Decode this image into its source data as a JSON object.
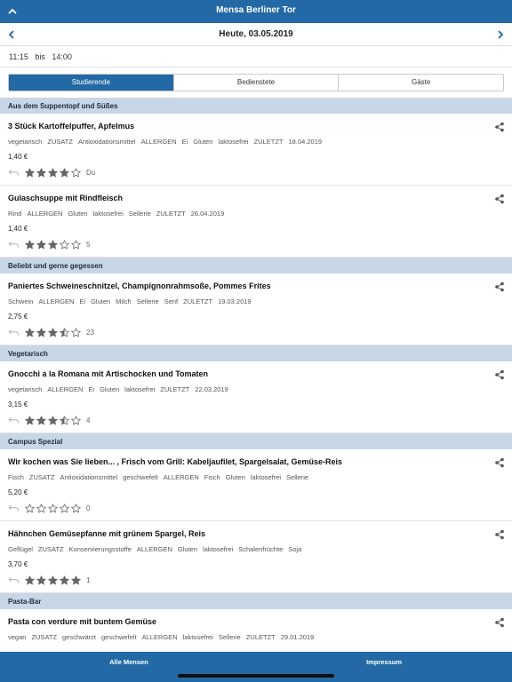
{
  "header": {
    "title": "Mensa Berliner Tor",
    "collapse_icon": "chevron-up-icon"
  },
  "datebar": {
    "date": "Heute, 03.05.2019",
    "prev_icon": "chevron-left-icon",
    "next_icon": "chevron-right-icon"
  },
  "opening": {
    "from": "11:15",
    "sep": "bis",
    "to": "14:00"
  },
  "tabs": [
    {
      "label": "Studierende",
      "active": true
    },
    {
      "label": "Bedienstete",
      "active": false
    },
    {
      "label": "Gäste",
      "active": false
    }
  ],
  "sections": [
    {
      "title": "Aus dem Suppentopf und Süßes",
      "meals": [
        {
          "name": "3 Stück Kartoffelpuffer, Apfelmus",
          "tags": [
            "vegetarisch",
            "ZUSATZ",
            "Antioxidationsmittel",
            "ALLERGEN",
            "Ei",
            "Gluten",
            "laktosefrei",
            "ZULETZT",
            "18.04.2019"
          ],
          "price": "1,40 €",
          "rating": 4,
          "count": "Du"
        },
        {
          "name": "Gulaschsuppe mit Rindfleisch",
          "tags": [
            "Rind",
            "ALLERGEN",
            "Gluten",
            "laktosefrei",
            "Sellerie",
            "ZULETZT",
            "26.04.2019"
          ],
          "price": "1,40 €",
          "rating": 3,
          "count": "5"
        }
      ]
    },
    {
      "title": "Beliebt und gerne gegessen",
      "meals": [
        {
          "name": "Paniertes Schweineschnitzel, Champignonrahmsoße, Pommes Frites",
          "tags": [
            "Schwein",
            "ALLERGEN",
            "Ei",
            "Gluten",
            "Milch",
            "Sellerie",
            "Senf",
            "ZULETZT",
            "19.03.2019"
          ],
          "price": "2,75 €",
          "rating": 3.5,
          "count": "23"
        }
      ]
    },
    {
      "title": "Vegetarisch",
      "meals": [
        {
          "name": "Gnocchi a la Romana mit Artischocken und Tomaten",
          "tags": [
            "vegetarisch",
            "ALLERGEN",
            "Ei",
            "Gluten",
            "laktosefrei",
            "ZULETZT",
            "22.03.2019"
          ],
          "price": "3,15 €",
          "rating": 3.5,
          "count": "4"
        }
      ]
    },
    {
      "title": "Campus Spezial",
      "meals": [
        {
          "name": "Wir kochen was Sie lieben... , Frisch vom Grill: Kabeljaufilet, Spargelsalat, Gemüse-Reis",
          "tags": [
            "Fisch",
            "ZUSATZ",
            "Antioxidationsmittel",
            "geschwefelt",
            "ALLERGEN",
            "Fisch",
            "Gluten",
            "laktosefrei",
            "Sellerie"
          ],
          "price": "5,20 €",
          "rating": 0,
          "count": "0"
        },
        {
          "name": "Hähnchen Gemüsepfanne mit grünem Spargel, Reis",
          "tags": [
            "Geflügel",
            "ZUSATZ",
            "Konservierungsstoffe",
            "ALLERGEN",
            "Gluten",
            "laktosefrei",
            "Schalenfrüchte",
            "Soja"
          ],
          "price": "3,70 €",
          "rating": 5,
          "count": "1"
        }
      ]
    },
    {
      "title": "Pasta-Bar",
      "meals": [
        {
          "name": "Pasta con verdure mit buntem Gemüse",
          "tags": [
            "vegan",
            "ZUSATZ",
            "geschwärzt",
            "geschwefelt",
            "ALLERGEN",
            "laktosefrei",
            "Sellerie",
            "ZULETZT",
            "29.01.2019"
          ],
          "price": "",
          "rating": 0,
          "count": ""
        }
      ]
    }
  ],
  "footer": {
    "left": "Alle Mensen",
    "right": "Impressum"
  },
  "colors": {
    "primary": "#2369a6",
    "section_bg": "#c8d7e8",
    "star": "#666666"
  }
}
